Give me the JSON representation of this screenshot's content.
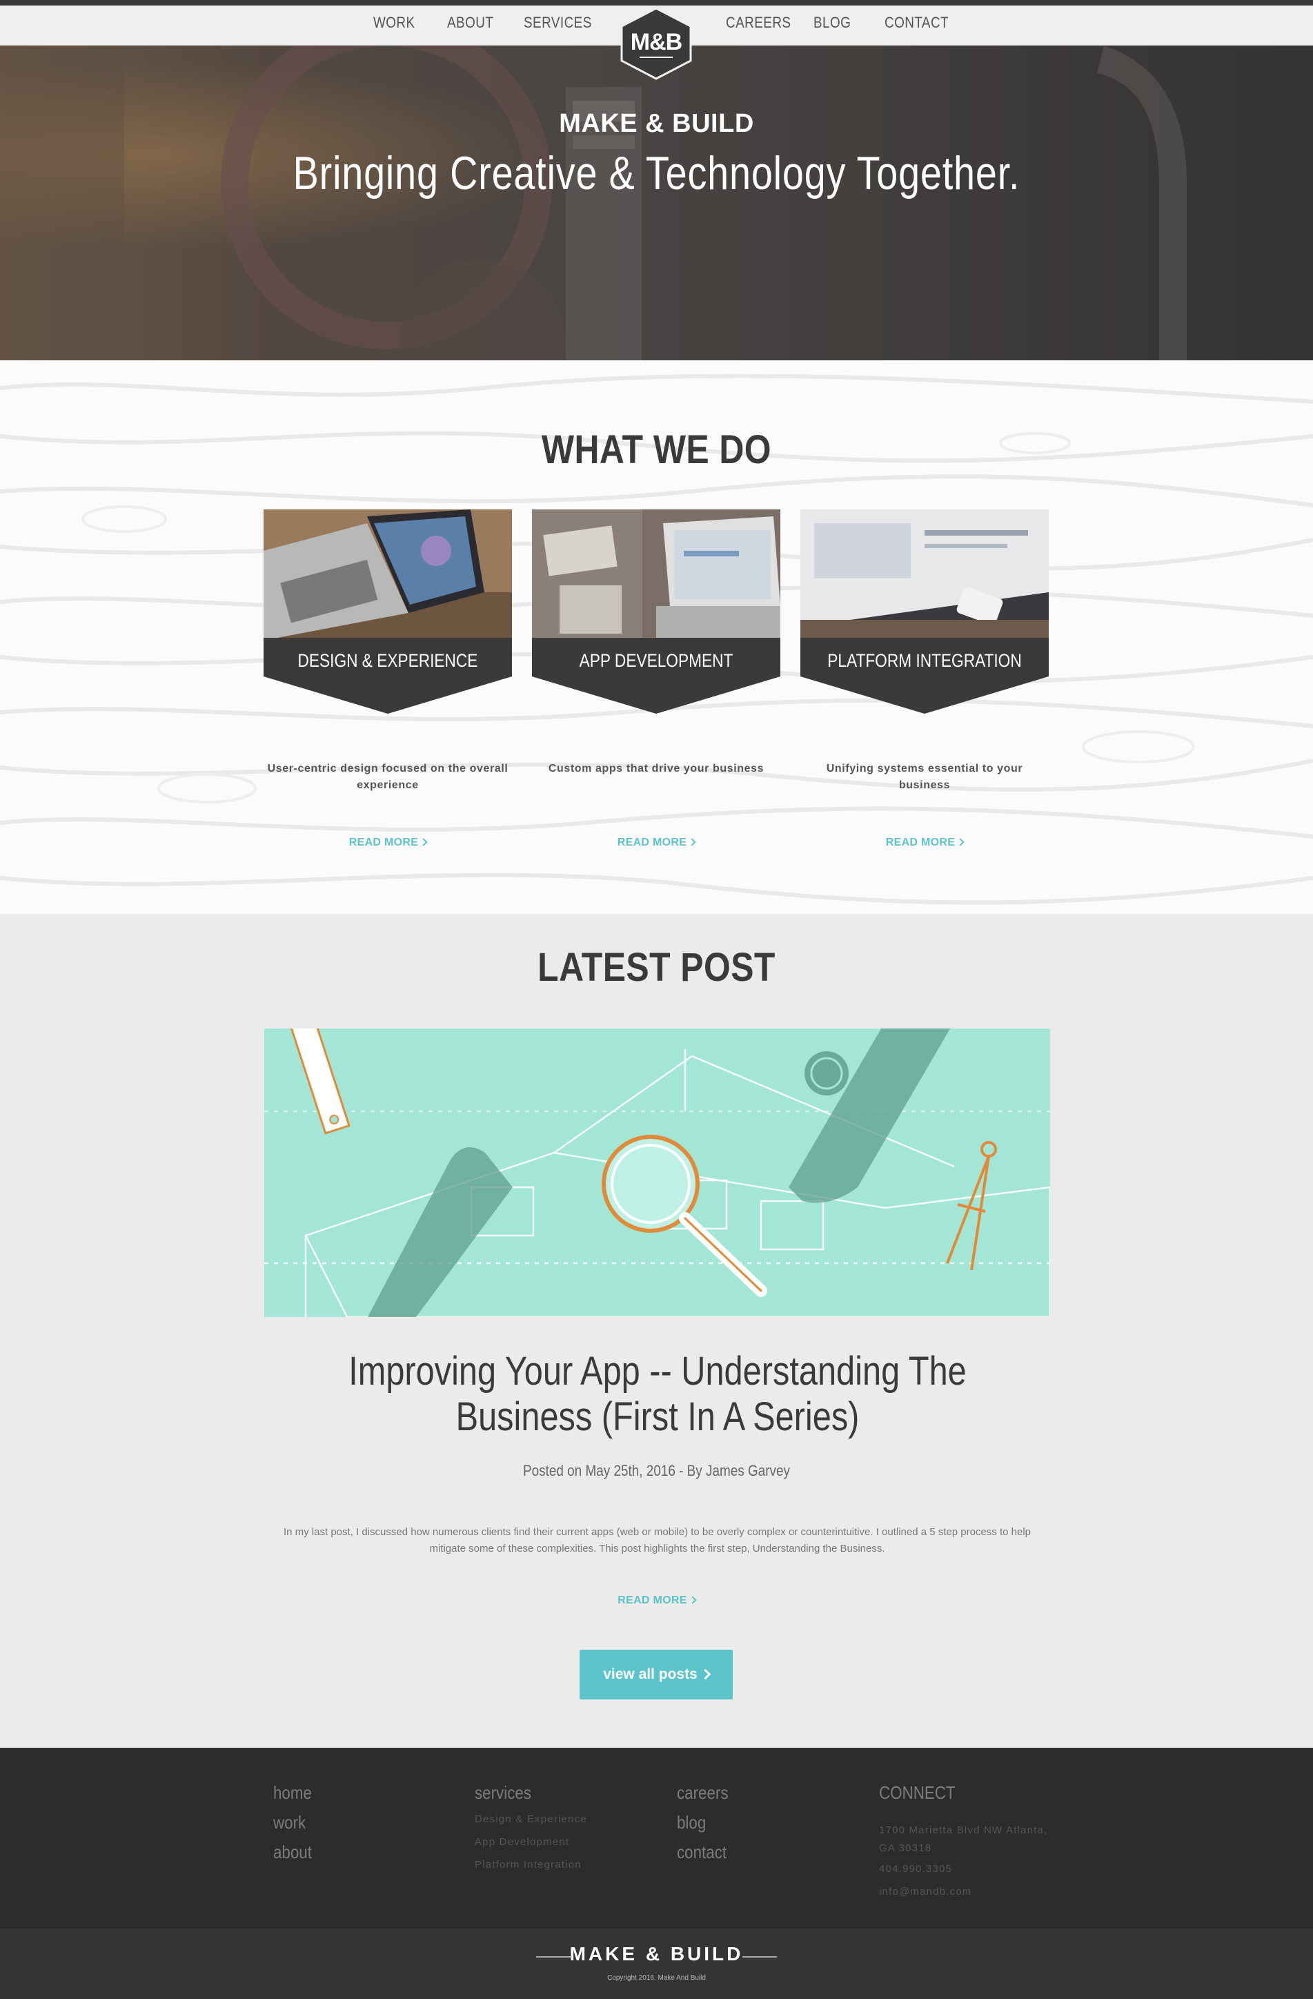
{
  "nav": {
    "left": [
      "WORK",
      "ABOUT",
      "SERVICES"
    ],
    "right": [
      "CAREERS",
      "BLOG",
      "CONTACT"
    ],
    "logo": "M&B"
  },
  "hero": {
    "subtitle": "MAKE & BUILD",
    "title": "Bringing Creative & Technology Together."
  },
  "what_we_do": {
    "title": "WHAT WE DO",
    "cards": [
      {
        "label": "DESIGN & EXPERIENCE",
        "desc": "User-centric design focused on the overall experience",
        "more": "READ MORE"
      },
      {
        "label": "APP DEVELOPMENT",
        "desc": "Custom apps that drive your business",
        "more": "READ MORE"
      },
      {
        "label": "PLATFORM INTEGRATION",
        "desc": "Unifying systems essential to your business",
        "more": "READ MORE"
      }
    ]
  },
  "latest_post": {
    "title": "LATEST POST",
    "post_title": "Improving Your App -- Understanding The Business (First In A Series)",
    "meta": "Posted on May 25th, 2016 - By James Garvey",
    "excerpt": "In my last post, I discussed how numerous clients find their current apps (web or mobile) to be overly complex or counterintuitive. I outlined a 5 step process to help mitigate some of these complexities. This post highlights the first step, Understanding the Business.",
    "more": "READ MORE",
    "view_all": "view all posts"
  },
  "footer": {
    "col1": [
      "home",
      "work",
      "about"
    ],
    "col2_title": "services",
    "col2": [
      "Design & Experience",
      "App Development",
      "Platform Integration"
    ],
    "col3": [
      "careers",
      "blog",
      "contact"
    ],
    "col4_title": "CONNECT",
    "address": "1700 Marietta Blvd NW Atlanta, GA 30318",
    "phone": "404.990.3305",
    "email": "info@mandb.com"
  },
  "bottom": {
    "brand": "MAKE & BUILD",
    "copyright": "Copyright 2016. Make And Build"
  },
  "colors": {
    "accent": "#5bc4cb",
    "dark": "#3a3a3a",
    "footer": "#2c2c2c"
  }
}
